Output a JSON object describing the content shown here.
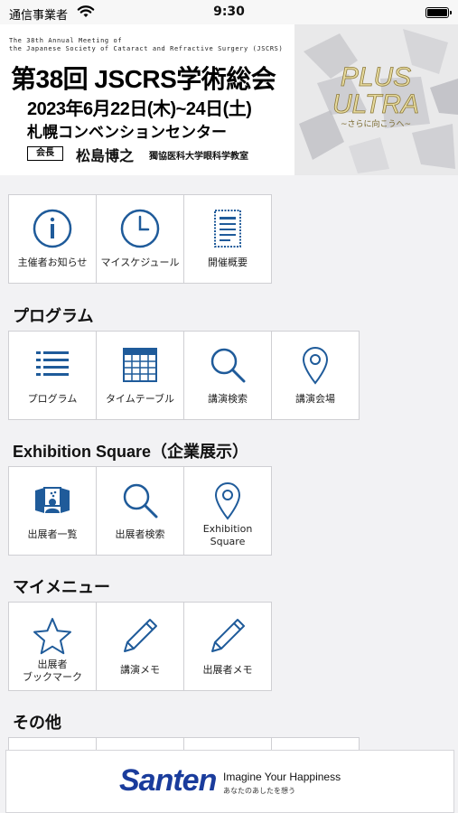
{
  "status": {
    "carrier": "通信事業者",
    "time": "9:30"
  },
  "banner": {
    "eng_line1": "The 38th Annual Meeting of",
    "eng_line2": "the Japanese Society of Cataract and Refractive Surgery (JSCRS)",
    "title": "第38回 JSCRS学術総会",
    "date": "2023年6月22日(木)~24日(土)",
    "venue": "札幌コンベンションセンター",
    "role": "会長",
    "president": "松島博之",
    "affiliation": "獨協医科大学眼科学教室",
    "art_line1": "PLUS",
    "art_line2": "ULTRA",
    "art_sub": "~さらに向こうへ~"
  },
  "main_grid": [
    {
      "label": "主催者お知らせ",
      "icon": "info-icon"
    },
    {
      "label": "マイスケジュール",
      "icon": "clock-icon"
    },
    {
      "label": "開催概要",
      "icon": "document-icon"
    }
  ],
  "sections": {
    "program": {
      "title": "プログラム",
      "items": [
        {
          "label": "プログラム",
          "icon": "list-icon"
        },
        {
          "label": "タイムテーブル",
          "icon": "calendar-icon"
        },
        {
          "label": "講演検索",
          "icon": "search-icon"
        },
        {
          "label": "講演会場",
          "icon": "location-pin-icon"
        }
      ]
    },
    "exhibition": {
      "title": "Exhibition Square（企業展示）",
      "items": [
        {
          "label": "出展者一覧",
          "icon": "exhibitor-icon"
        },
        {
          "label": "出展者検索",
          "icon": "search-icon"
        },
        {
          "label": "Exhibition\nSquare",
          "icon": "location-pin-icon"
        }
      ]
    },
    "mymenu": {
      "title": "マイメニュー",
      "items": [
        {
          "label": "出展者\nブックマーク",
          "icon": "star-icon"
        },
        {
          "label": "講演メモ",
          "icon": "pencil-icon"
        },
        {
          "label": "出展者メモ",
          "icon": "pencil-icon"
        }
      ]
    },
    "other": {
      "title": "その他"
    }
  },
  "footer": {
    "logo": "Santen",
    "tagline": "Imagine Your Happiness",
    "tagline_jp": "あなたのあしたを想う"
  },
  "colors": {
    "icon_blue": "#1f5b9a",
    "background": "#f2f2f4",
    "brand_blue": "#1a3c9c"
  }
}
